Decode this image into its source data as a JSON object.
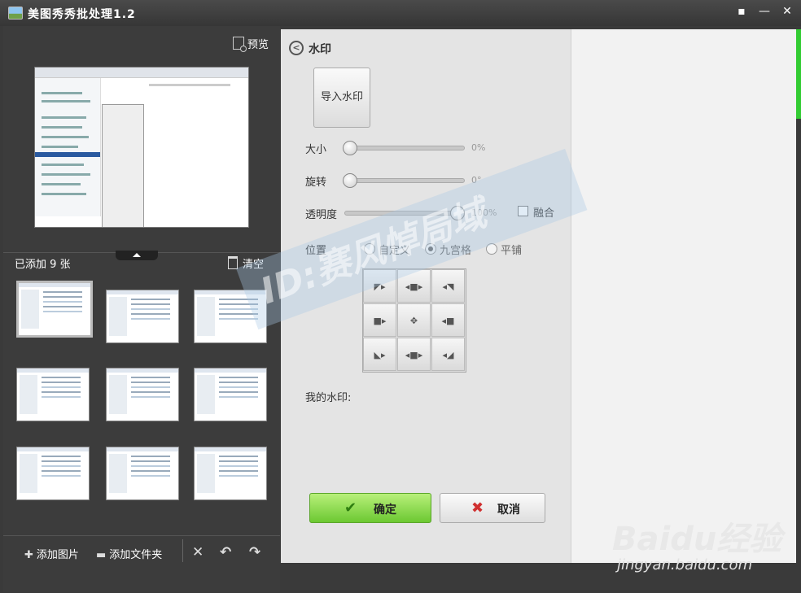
{
  "window": {
    "title": "美图秀秀批处理1.2",
    "icons": [
      "app-icon",
      "feedback-icon",
      "minimize-icon",
      "close-icon"
    ]
  },
  "left": {
    "preview_label": "预览",
    "added_count": "已添加 9 张",
    "clear_label": "清空",
    "toolbar": {
      "add_image": "添加图片",
      "add_folder": "添加文件夹"
    }
  },
  "watermark_panel": {
    "title": "水印",
    "import_button": "导入水印",
    "size": {
      "label": "大小",
      "value": "0%",
      "level": 0
    },
    "rotate": {
      "label": "旋转",
      "value": "0°",
      "level": 0
    },
    "opacity": {
      "label": "透明度",
      "value": "100%",
      "level": 100
    },
    "blend_label": "融合",
    "position": {
      "label": "位置",
      "options": [
        "自定义",
        "九宫格",
        "平铺"
      ],
      "selected": "九宫格"
    },
    "my_watermark": "我的水印:",
    "ok_button": "确定",
    "cancel_button": "取消"
  },
  "overlay": {
    "watermark_text": "ID:赛风悼局域",
    "logo": "Baidu经验",
    "site": "jingyan.baidu.com"
  },
  "colors": {
    "ok_green": "#6cc832",
    "cancel_x": "#d03030",
    "accent_edge": "#33cc33"
  }
}
